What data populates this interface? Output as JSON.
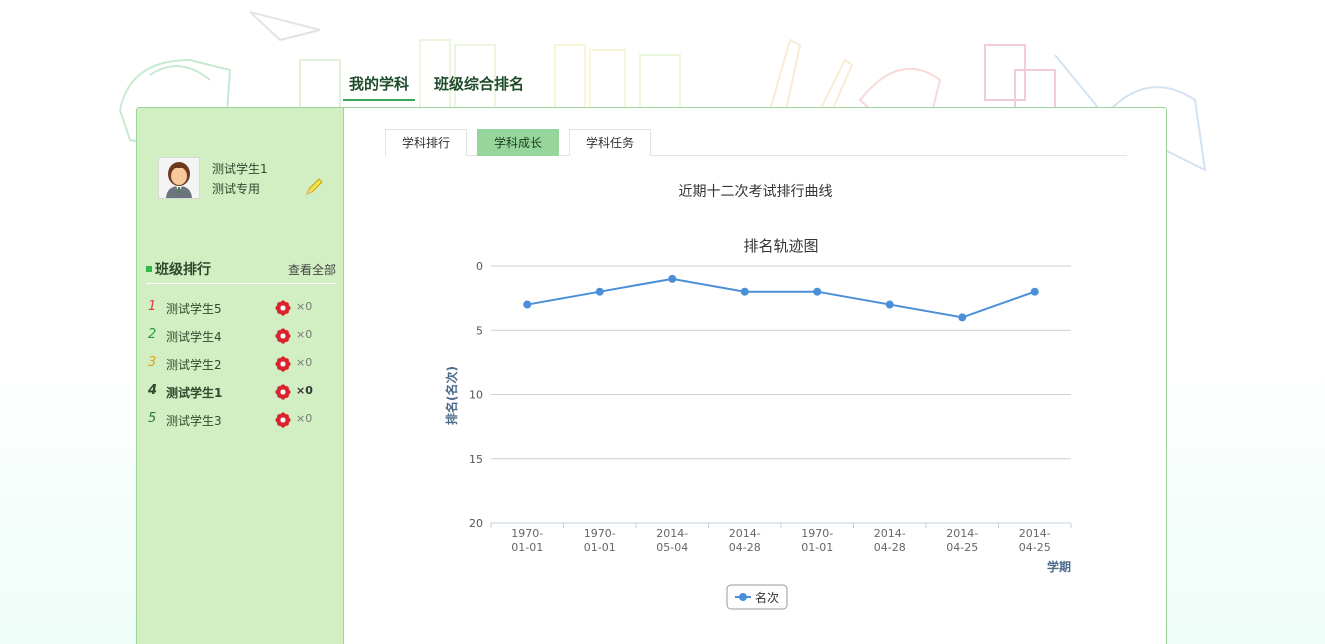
{
  "top_nav": [
    {
      "label": "我的学科",
      "active": true
    },
    {
      "label": "班级综合排名",
      "active": false
    }
  ],
  "user": {
    "name": "测试学生1",
    "tag": "测试专用"
  },
  "rank_panel": {
    "title": "班级排行",
    "view_all": "查看全部",
    "items": [
      {
        "rank": "1",
        "name": "测试学生5",
        "count": "×0",
        "color": "#e23a3a",
        "me": false
      },
      {
        "rank": "2",
        "name": "测试学生4",
        "count": "×0",
        "color": "#2a9a3a",
        "me": false
      },
      {
        "rank": "3",
        "name": "测试学生2",
        "count": "×0",
        "color": "#e0a020",
        "me": false
      },
      {
        "rank": "4",
        "name": "测试学生1",
        "count": "×0",
        "color": "#2d4a2d",
        "me": true
      },
      {
        "rank": "5",
        "name": "测试学生3",
        "count": "×0",
        "color": "#2a7a3a",
        "me": false
      }
    ]
  },
  "tabs": [
    {
      "label": "学科排行",
      "active": false
    },
    {
      "label": "学科成长",
      "active": true
    },
    {
      "label": "学科任务",
      "active": false
    }
  ],
  "subtitle": "近期十二次考试排行曲线",
  "colors": {
    "accent": "#96d59b",
    "sidebar": "#d2efc4",
    "series": "#4a8fd8",
    "flower": "#d9232e"
  },
  "chart_data": {
    "type": "line",
    "title": "排名轨迹图",
    "xlabel": "学期",
    "ylabel": "排名(名次)",
    "categories": [
      "1970-01-01",
      "1970-01-01",
      "2014-05-04",
      "2014-04-28",
      "1970-01-01",
      "2014-04-28",
      "2014-04-25",
      "2014-04-25"
    ],
    "ylim": [
      0,
      20
    ],
    "y_reversed": true,
    "yticks": [
      0,
      5,
      10,
      15,
      20
    ],
    "grid": true,
    "legend": "bottom-center",
    "series": [
      {
        "name": "名次",
        "values": [
          3,
          2,
          1,
          2,
          2,
          3,
          4,
          2
        ]
      }
    ]
  }
}
